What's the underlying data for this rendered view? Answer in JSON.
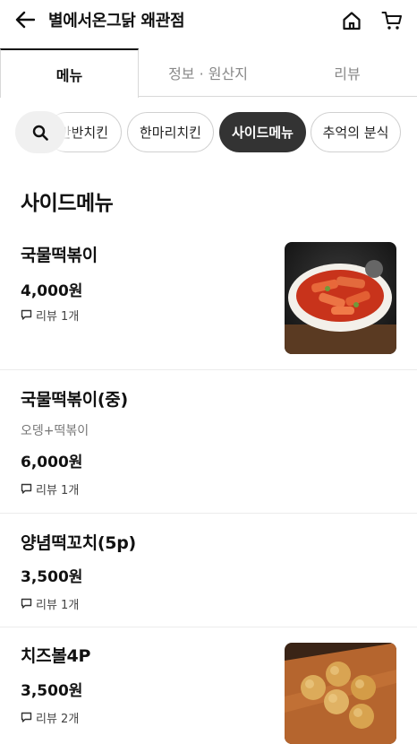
{
  "header": {
    "title": "별에서온그닭 왜관점",
    "back_icon": "arrow-left-icon",
    "home_icon": "home-icon",
    "cart_icon": "cart-icon"
  },
  "tabs": [
    {
      "label": "메뉴",
      "active": true
    },
    {
      "label": "정보 · 원산지",
      "active": false
    },
    {
      "label": "리뷰",
      "active": false
    }
  ],
  "chips": {
    "search_icon": "search-icon",
    "items": [
      {
        "label": "반반치킨",
        "active": false
      },
      {
        "label": "한마리치킨",
        "active": false
      },
      {
        "label": "사이드메뉴",
        "active": true
      },
      {
        "label": "추억의 분식",
        "active": false
      }
    ]
  },
  "section": {
    "title": "사이드메뉴"
  },
  "menu": [
    {
      "name": "국물떡볶이",
      "description": "",
      "price": "4,000원",
      "review": "리뷰 1개",
      "has_image": true
    },
    {
      "name": "국물떡볶이(중)",
      "description": "오뎅+떡볶이",
      "price": "6,000원",
      "review": "리뷰 1개",
      "has_image": false
    },
    {
      "name": "양념떡꼬치(5p)",
      "description": "",
      "price": "3,500원",
      "review": "리뷰 1개",
      "has_image": false
    },
    {
      "name": "치즈볼4P",
      "description": "",
      "price": "3,500원",
      "review": "리뷰 2개",
      "has_image": true
    }
  ],
  "colors": {
    "accent": "#333333",
    "divider": "#ececec",
    "muted": "#777777"
  }
}
